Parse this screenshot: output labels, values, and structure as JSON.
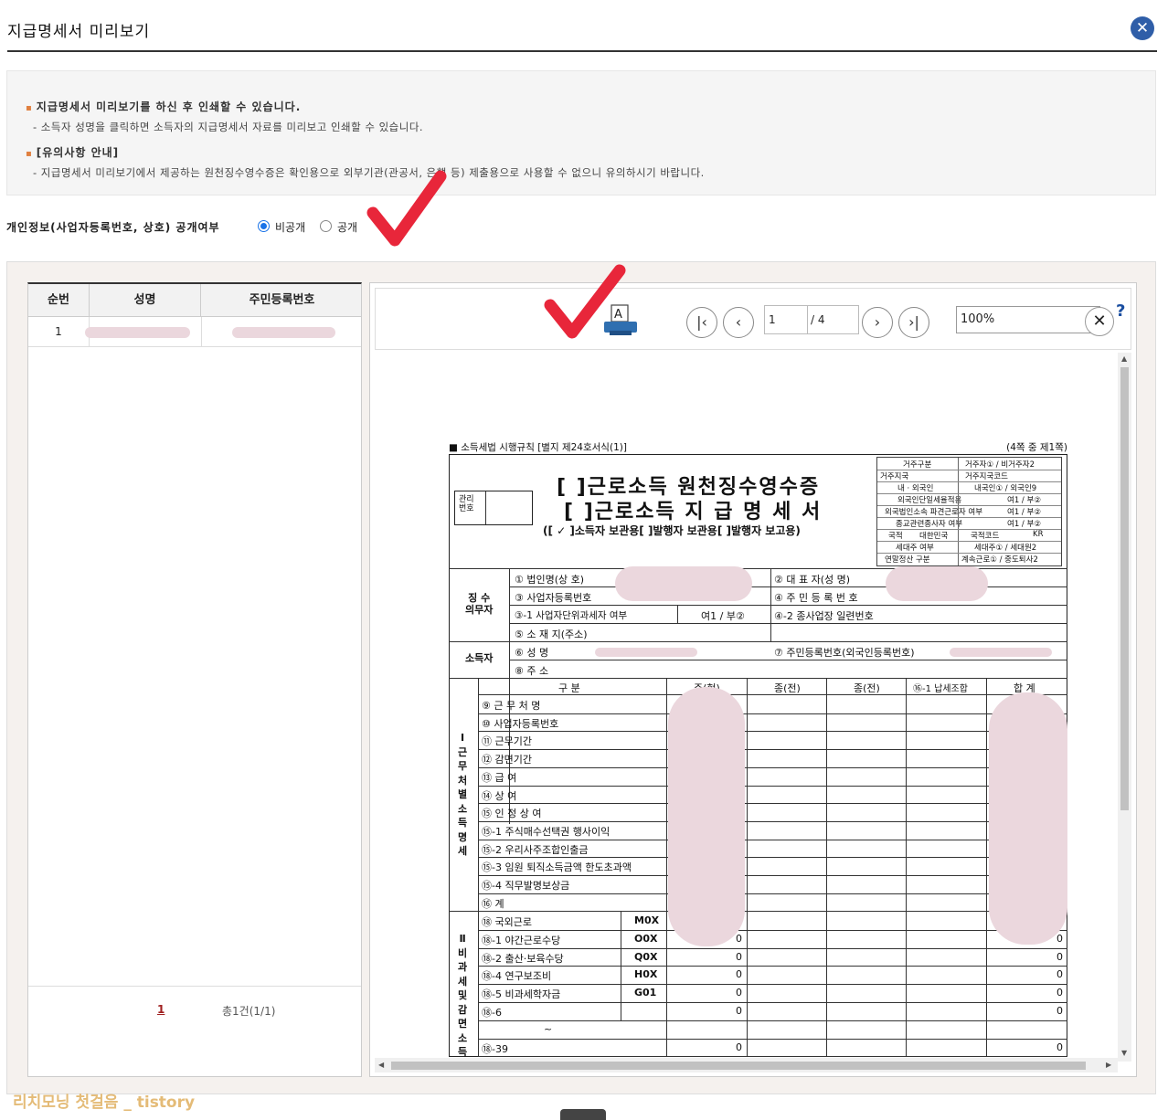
{
  "header": {
    "title": "지급명세서 미리보기",
    "close_icon": "close-icon"
  },
  "notice": {
    "title1": "지급명세서 미리보기를 하신 후 인쇄할 수 있습니다.",
    "desc1": "- 소득자 성명을 클릭하면 소득자의 지급명세서 자료를 미리보고 인쇄할 수 있습니다.",
    "title2": "[유의사항 안내]",
    "desc2": "- 지급명세서 미리보기에서 제공하는 원천징수영수증은 확인용으로 외부기관(관공서, 은행 등) 제출용으로 사용할 수 없으니 유의하시기 바랍니다."
  },
  "privacy": {
    "label": "개인정보(사업자등록번호, 상호) 공개여부",
    "options": [
      "비공개",
      "공개"
    ],
    "selected": "비공개"
  },
  "list": {
    "headers": [
      "순번",
      "성명",
      "주민등록번호"
    ],
    "rows": [
      {
        "no": "1",
        "name": "",
        "rrn": ""
      }
    ],
    "page": "1",
    "total": "총1건(1/1)"
  },
  "viewer": {
    "print_label": "A",
    "page_current": "1",
    "page_total": "/ 4",
    "zoom": "100%",
    "help": "?"
  },
  "form": {
    "top_left": "■ 소득세법 시행규칙 [별지 제24호서식(1)]",
    "top_right": "(4쪽 중 제1쪽)",
    "mgmt_no": "관리\n번호",
    "title1": "[ ]근로소득 원천징수영수증",
    "title2": "[ ]근로소득 지 급 명 세 서",
    "subtitle": "([ ✓ ]소득자 보관용[    ]발행자 보관용[    ]발행자 보고용)",
    "side": [
      [
        "거주구분",
        "거주자① / 비거주자2"
      ],
      [
        "거주지국",
        "거주지국코드"
      ],
      [
        "내 · 외국인",
        "내국인① / 외국인9"
      ],
      [
        "외국인단일세율적용",
        "여1 / 부②"
      ],
      [
        "외국법인소속 파견근로자 여부",
        "여1 / 부②"
      ],
      [
        "종교관련종사자 여부",
        "여1 / 부②"
      ],
      [
        "국적",
        "대한민국",
        "국적코드",
        "KR"
      ],
      [
        "세대주 여부",
        "세대주① / 세대원2"
      ],
      [
        "연말정산 구분",
        "계속근로① / 중도퇴사2"
      ]
    ],
    "payer_label": "징 수\n의무자",
    "payer": {
      "corp": "① 법인명(상 호)",
      "ceo": "② 대 표 자(성 명)",
      "bizno": "③ 사업자등록번호",
      "rrn": "④ 주 민 등 록 번 호",
      "unit": "③-1 사업자단위과세자 여부",
      "unit_val": "여1 / 부②",
      "sub": "④-2 종사업장 일련번호",
      "addr": "⑤ 소 재 지(주소)"
    },
    "earner_label": "소득자",
    "earner": {
      "name": "⑥ 성          명",
      "rrn": "⑦ 주민등록번호(외국인등록번호)",
      "addr": "⑧ 주          소"
    },
    "section1_label": "Ⅰ\n근\n무\n처\n별\n소\n득\n명\n세",
    "table_headers": [
      "구    분",
      "주(현)",
      "종(전)",
      "종(전)",
      "⑯-1 납세조합",
      "합  계"
    ],
    "section1_rows": [
      "⑨ 근 무 처 명",
      "⑩ 사업자등록번호",
      "⑪ 근무기간",
      "⑫ 감면기간",
      "⑬ 급          여",
      "⑭ 상          여",
      "⑮ 인 정 상 여",
      "⑮-1 주식매수선택권 행사이익",
      "⑮-2 우리사주조합인출금",
      "⑮-3 임원 퇴직소득금액 한도초과액",
      "⑮-4 직무발명보상금",
      "⑯ 계"
    ],
    "section2_label": "Ⅱ\n비\n과\n세\n및\n감\n면\n소\n득",
    "section2_rows": [
      {
        "label": "⑱ 국외근로",
        "code": "M0X",
        "v1": "",
        "v5": ""
      },
      {
        "label": "⑱-1 야간근로수당",
        "code": "O0X",
        "v1": "0",
        "v5": "0"
      },
      {
        "label": "⑱-2 출산·보육수당",
        "code": "Q0X",
        "v1": "0",
        "v5": "0"
      },
      {
        "label": "⑱-4 연구보조비",
        "code": "H0X",
        "v1": "0",
        "v5": "0"
      },
      {
        "label": "⑱-5 비과세학자금",
        "code": "G01",
        "v1": "0",
        "v5": "0"
      },
      {
        "label": "⑱-6",
        "code": "",
        "v1": "0",
        "v5": "0"
      },
      {
        "label": "~",
        "code": "",
        "v1": "",
        "v5": ""
      },
      {
        "label": "⑱-39",
        "code": "",
        "v1": "0",
        "v5": "0"
      }
    ]
  },
  "watermark": "리치모닝 첫걸음 _ tistory"
}
